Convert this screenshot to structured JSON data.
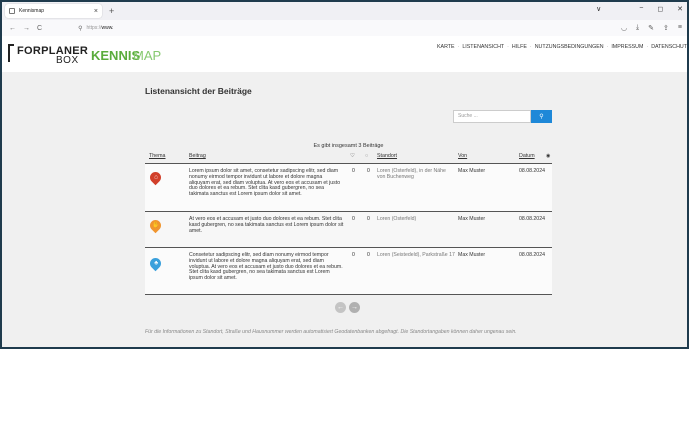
{
  "browser": {
    "tab_title": "Kennismap",
    "tab_close": "×",
    "new_tab": "+",
    "url_prefix": "https://",
    "url_host": "www.",
    "nav_back": "←",
    "nav_forward": "→",
    "nav_reload": "C",
    "win_chevron": "∨",
    "win_min": "−",
    "win_max": "◻",
    "win_close": "✕"
  },
  "header": {
    "logo_left": "FORPLANER",
    "logo_box": "BOX",
    "logo_kennis": "KENNIS",
    "logo_map": "MAP",
    "nav": [
      "KARTE",
      "LISTENANSICHT",
      "HILFE",
      "NUTZUNGSBEDINGUNGEN",
      "IMPRESSUM",
      "DATENSCHUT"
    ]
  },
  "page": {
    "title": "Listenansicht der Beiträge",
    "search_placeholder": "Suche ...",
    "search_icon": "🔍",
    "count_text": "Es gibt insgesamt 3 Beiträge",
    "columns": {
      "thema": "Thema",
      "beitrag": "Beitrag",
      "likes_icon": "👍",
      "comments_icon": "💬",
      "standort": "Standort",
      "von": "Von",
      "datum": "Datum"
    },
    "rows": [
      {
        "text": "Lorem ipsum dolor sit amet, consetetur sadipscing elitr, sed diam nonumy eirmod tempor invidunt ut labore et dolore magna aliquyam erat, sed diam voluptua. At vero eos et accusam et justo duo dolores et ea rebum. Stet clita kasd gubergren, no sea takimata sanctus est Lorem ipsum dolor sit amet.",
        "likes": "0",
        "comments": "0",
        "place": "Loren (Osterfeld), in der Nähe von Buchenweg",
        "user": "Max Muster",
        "date": "08.08.2024",
        "pin_color": "#d13f2a",
        "icon": "house-icon"
      },
      {
        "text": "At vero eos et accusam et justo duo dolores et ea rebum. Stet clita kasd gubergren, no sea takimata sanctus est Lorem ipsum dolor sit amet.",
        "likes": "0",
        "comments": "0",
        "place": "Loren (Osterfeld)",
        "user": "Max Muster",
        "date": "08.08.2024",
        "pin_color": "#f0952e",
        "icon": "hand-icon"
      },
      {
        "text": "Consetetur sadipscing elitr, sed diam nonumy eirmod tempor invidunt ut labore et dolore magna aliquyam erat, sed diam voluptua. At vero eos et accusam et justo duo dolores et ea rebum. Stet clita kasd gubergren, no sea takimata sanctus est Lorem ipsum dolor sit amet.",
        "likes": "0",
        "comments": "0",
        "place": "Loren (Seistedeld), Parkstraße 17",
        "user": "Max Muster",
        "date": "08.08.2024",
        "pin_color": "#3aa0dc",
        "icon": "tree-icon"
      }
    ],
    "pager_prev": "←",
    "pager_next": "→",
    "footnote": "Für die Informationen zu Standort, Straße und Hausnummer werden automatisiert Geodatenbanken abgefragt. Die Standortangaben können daher ungenau sein."
  }
}
